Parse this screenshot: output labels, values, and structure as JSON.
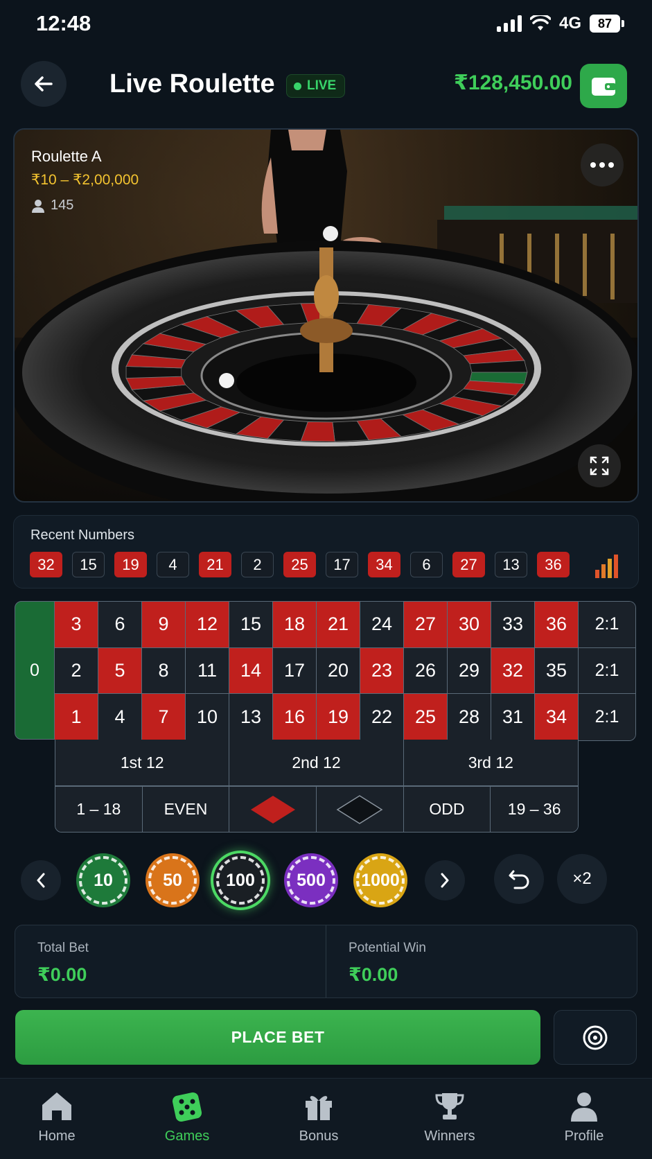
{
  "status": {
    "time": "12:48",
    "network": "4G",
    "battery": "87"
  },
  "header": {
    "title": "Live Roulette",
    "live_label": "LIVE",
    "balance": "₹128,450.00"
  },
  "video": {
    "table_name": "Roulette A",
    "limits": "₹10 – ₹2,00,000",
    "viewers": "145"
  },
  "recent": {
    "title": "Recent Numbers",
    "numbers": [
      {
        "n": "32",
        "color": "red"
      },
      {
        "n": "15",
        "color": "black"
      },
      {
        "n": "19",
        "color": "red"
      },
      {
        "n": "4",
        "color": "black"
      },
      {
        "n": "21",
        "color": "red"
      },
      {
        "n": "2",
        "color": "black"
      },
      {
        "n": "25",
        "color": "red"
      },
      {
        "n": "17",
        "color": "black"
      },
      {
        "n": "34",
        "color": "red"
      },
      {
        "n": "6",
        "color": "black"
      },
      {
        "n": "27",
        "color": "red"
      },
      {
        "n": "13",
        "color": "black"
      },
      {
        "n": "36",
        "color": "red"
      }
    ]
  },
  "board": {
    "zero": "0",
    "rows": [
      [
        "3",
        "6",
        "9",
        "12",
        "15",
        "18",
        "21",
        "24",
        "27",
        "30",
        "33",
        "36"
      ],
      [
        "2",
        "5",
        "8",
        "11",
        "14",
        "17",
        "20",
        "23",
        "26",
        "29",
        "32",
        "35"
      ],
      [
        "1",
        "4",
        "7",
        "10",
        "13",
        "16",
        "19",
        "22",
        "25",
        "28",
        "31",
        "34"
      ]
    ],
    "red_numbers": [
      "1",
      "3",
      "5",
      "7",
      "9",
      "12",
      "14",
      "16",
      "18",
      "19",
      "21",
      "23",
      "25",
      "27",
      "30",
      "32",
      "34",
      "36"
    ],
    "column_label": "2:1",
    "dozens": [
      "1st 12",
      "2nd 12",
      "3rd 12"
    ],
    "outside": {
      "low": "1 – 18",
      "even": "EVEN",
      "odd": "ODD",
      "high": "19 – 36"
    }
  },
  "chips": [
    {
      "value": "10",
      "color": "#1e7a3a"
    },
    {
      "value": "50",
      "color": "#d9741a"
    },
    {
      "value": "100",
      "color": "#1a1f24",
      "selected": true
    },
    {
      "value": "500",
      "color": "#7b2fc0"
    },
    {
      "value": "1000",
      "color": "#d9a514"
    }
  ],
  "actions": {
    "double_label": "×2",
    "place_bet": "PLACE BET"
  },
  "summary": {
    "total_bet_label": "Total Bet",
    "total_bet": "₹0.00",
    "potential_win_label": "Potential Win",
    "potential_win": "₹0.00"
  },
  "nav": [
    {
      "label": "Home",
      "icon": "home-icon"
    },
    {
      "label": "Games",
      "icon": "dice-icon",
      "active": true
    },
    {
      "label": "Bonus",
      "icon": "gift-icon"
    },
    {
      "label": "Winners",
      "icon": "trophy-icon"
    },
    {
      "label": "Profile",
      "icon": "user-icon"
    }
  ],
  "colors": {
    "accent": "#3fce5a",
    "red": "#c0201d",
    "green_zero": "#1a6b35",
    "bg": "#0c141c"
  }
}
